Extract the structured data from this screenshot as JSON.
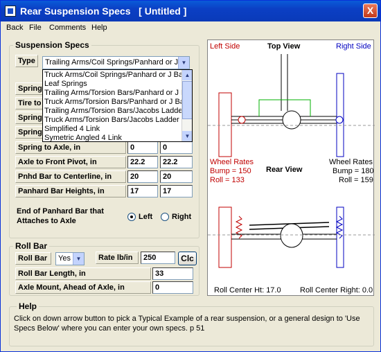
{
  "window": {
    "title": "Rear Suspension Specs   [ Untitled ]",
    "close_label": "X"
  },
  "menu": [
    "Back",
    "File",
    "Comments",
    "Help"
  ],
  "suspension": {
    "legend": "Suspension Specs",
    "type_label": "Type",
    "type_value": "Trailing Arms/Coil Springs/Panhard or J Bar",
    "type_options": [
      "Truck Arms/Coil Springs/Panhard or J Bar",
      "Leaf Springs",
      "Trailing Arms/Torsion Bars/Panhard or J Bar",
      "Truck Arms/Torsion Bars/Panhard or J Bar",
      "Trailing Arms/Torsion Bars/Jacobs Ladder",
      "Truck Arms/Torsion Bars/Jacobs Ladder",
      "Simplified 4 Link",
      "Symetric Angled 4 Link"
    ],
    "hidden_rows": [
      {
        "label": "Spring",
        "left": "",
        "right": ""
      },
      {
        "label": "Tire to",
        "left": "",
        "right": ""
      },
      {
        "label": "Spring",
        "left": "",
        "right": ""
      },
      {
        "label": "Spring",
        "left": "",
        "right": ""
      }
    ],
    "rows": [
      {
        "label": "Spring to Axle, in",
        "left": "0",
        "right": "0"
      },
      {
        "label": "Axle to Front Pivot, in",
        "left": "22.2",
        "right": "22.2"
      },
      {
        "label": "Pnhd Bar to Centerline, in",
        "left": "20",
        "right": "20"
      },
      {
        "label": "Panhard Bar Heights, in",
        "left": "17",
        "right": "17"
      }
    ],
    "end_label": "End of Panhard Bar that Attaches to Axle",
    "end_left": "Left",
    "end_right": "Right"
  },
  "rollbar": {
    "legend": "Roll Bar",
    "label": "Roll Bar",
    "select_value": "Yes",
    "rate_label": "Rate lb/in",
    "rate_value": "250",
    "clc_label": "Clc",
    "length_label": "Roll Bar Length, in",
    "length_value": "33",
    "mount_label": "Axle Mount, Ahead of Axle, in",
    "mount_value": "0"
  },
  "diagram": {
    "left_side": "Left Side",
    "top_view": "Top View",
    "right_side": "Right Side",
    "wheel_rates": "Wheel Rates",
    "left_bump": "Bump = 150",
    "left_roll": "Roll = 133",
    "rear_view": "Rear View",
    "right_bump": "Bump = 180",
    "right_roll": "Roll = 159",
    "roll_center_ht": "Roll Center Ht: 17.0",
    "roll_center_right": "Roll Center Right: 0.0",
    "colors": {
      "left": "#c00000",
      "right": "#0000c0",
      "link": "#00b000"
    }
  },
  "help": {
    "legend": "Help",
    "text": "Click on down arrow button to pick a Typical Example of a rear suspension, or a general design to 'Use Specs Below' where you can enter your own specs.  p 51"
  }
}
